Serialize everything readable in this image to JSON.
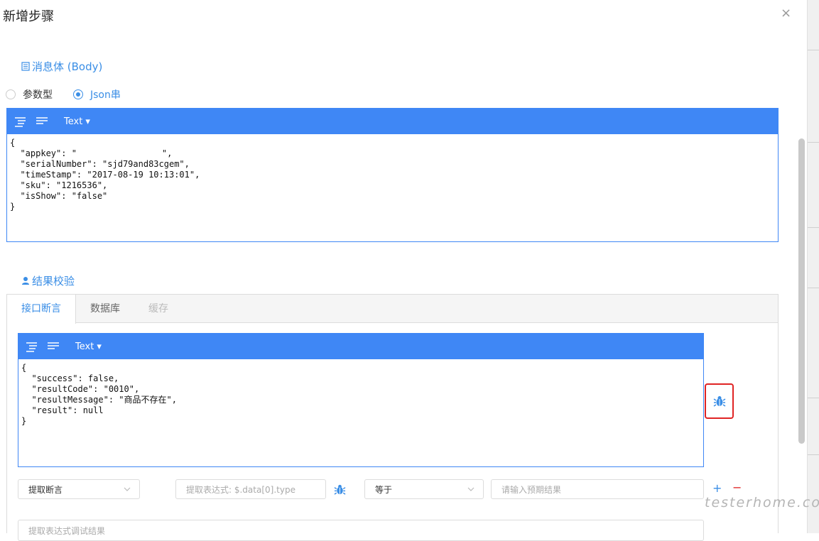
{
  "dialog": {
    "title": "新增步骤",
    "close_glyph": "×"
  },
  "body_section": {
    "heading": "消息体 (Body)",
    "icon": "document-icon"
  },
  "body_type": {
    "options": [
      "参数型",
      "Json串"
    ],
    "selected": "Json串"
  },
  "editor1": {
    "mode": "Text ▾",
    "lines": [
      "{",
      "  \"appkey\": \"",
      "  \"serialNumber\": \"sjd79and83cgem\",",
      "  \"timeStamp\": \"2017-08-19 10:13:01\",",
      "  \"sku\": \"1216536\",",
      "  \"isShow\": \"false\"",
      "}"
    ],
    "appkey_suffix": "\","
  },
  "result_section": {
    "heading": "结果校验",
    "icon": "user-icon"
  },
  "tabs": [
    {
      "label": "接口断言",
      "state": "active"
    },
    {
      "label": "数据库",
      "state": "normal"
    },
    {
      "label": "缓存",
      "state": "disabled"
    }
  ],
  "editor2": {
    "mode": "Text ▾",
    "lines": [
      "{",
      "  \"success\": false,",
      "  \"resultCode\": \"0010\",",
      "  \"resultMessage\": \"商品不存在\",",
      "  \"result\": null",
      "}"
    ]
  },
  "assert_row": {
    "type_value": "提取断言",
    "expression_placeholder": "提取表达式: $.data[0].type",
    "operator_value": "等于",
    "expected_placeholder": "请输入预期结果",
    "add_glyph": "+",
    "remove_glyph": "−"
  },
  "debug_result": {
    "placeholder": "提取表达式调试结果"
  },
  "watermark": "testerhome.com",
  "colors": {
    "accent": "#3a8ee6",
    "editor_bar": "#3f87f5",
    "highlight": "#e02424",
    "remove": "#e02424"
  }
}
